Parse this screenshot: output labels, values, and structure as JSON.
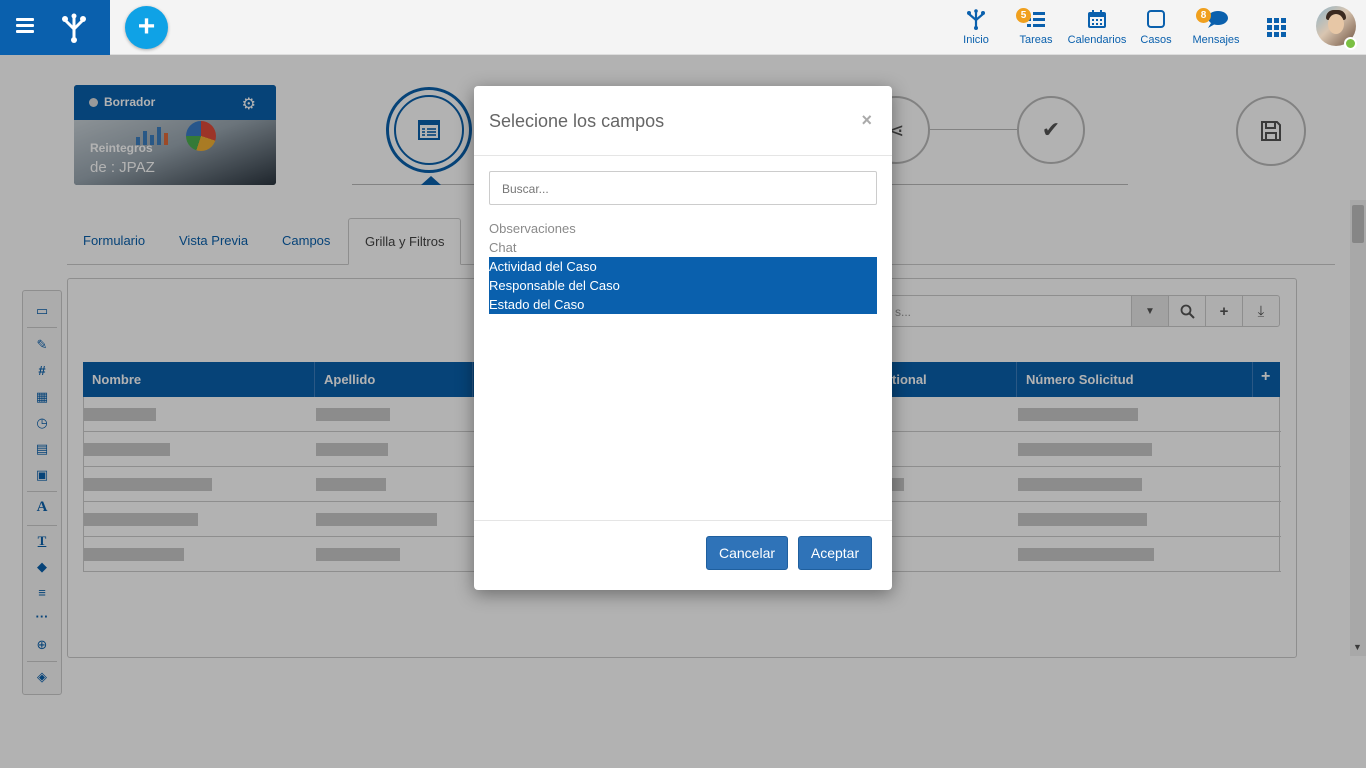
{
  "topnav": {
    "items": [
      {
        "label": "Inicio"
      },
      {
        "label": "Tareas",
        "badge": "5"
      },
      {
        "label": "Calendarios"
      },
      {
        "label": "Casos"
      },
      {
        "label": "Mensajes",
        "badge": "8"
      }
    ]
  },
  "doc_card": {
    "status": "Borrador",
    "line1": "Reintegros",
    "line2": "de : JPAZ"
  },
  "tabs": [
    {
      "label": "Formulario"
    },
    {
      "label": "Vista Previa"
    },
    {
      "label": "Campos"
    },
    {
      "label": "Grilla y Filtros",
      "active": true
    }
  ],
  "grid": {
    "search_placeholder": "s...",
    "columns": [
      "Nombre",
      "Apellido",
      "tional",
      "Número Solicitud"
    ],
    "add_column": "+"
  },
  "modal": {
    "title": "Selecione los campos",
    "close": "×",
    "search_placeholder": "Buscar...",
    "fields": [
      {
        "label": "Observaciones",
        "selected": false
      },
      {
        "label": "Chat",
        "selected": false
      },
      {
        "label": "Actividad del Caso",
        "selected": true
      },
      {
        "label": "Responsable del Caso",
        "selected": true
      },
      {
        "label": "Estado del Caso",
        "selected": true
      }
    ],
    "cancel": "Cancelar",
    "accept": "Aceptar"
  },
  "colors": {
    "primary": "#0a60ad",
    "accent": "#0fa2e6",
    "badge": "#f0a01e",
    "online": "#7bc043"
  }
}
